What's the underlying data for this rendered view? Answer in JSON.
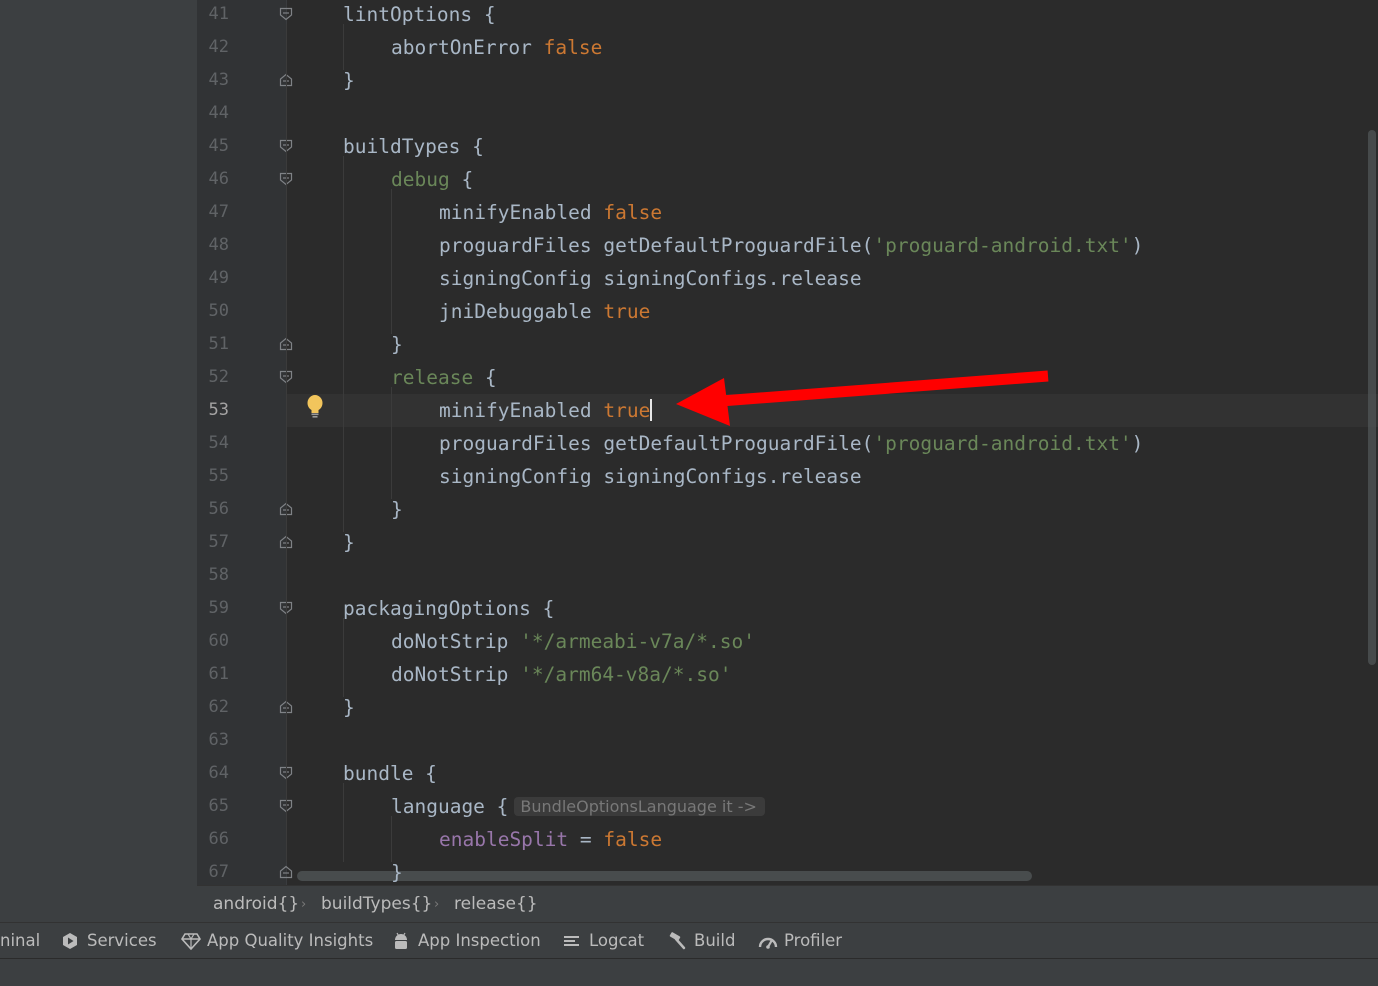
{
  "editor": {
    "current_line": "53",
    "lines": [
      {
        "no": "41",
        "tokens": [
          {
            "t": "lintOptions {"
          }
        ]
      },
      {
        "no": "42",
        "tokens": [
          {
            "t": "abortOnError "
          },
          {
            "t": "false",
            "c": "kw"
          }
        ]
      },
      {
        "no": "43",
        "tokens": [
          {
            "t": "}"
          }
        ]
      },
      {
        "no": "44",
        "tokens": []
      },
      {
        "no": "45",
        "tokens": [
          {
            "t": "buildTypes {"
          }
        ]
      },
      {
        "no": "46",
        "tokens": [
          {
            "t": "debug",
            "c": "green"
          },
          {
            "t": " {"
          }
        ]
      },
      {
        "no": "47",
        "tokens": [
          {
            "t": "minifyEnabled "
          },
          {
            "t": "false",
            "c": "kw"
          }
        ]
      },
      {
        "no": "48",
        "tokens": [
          {
            "t": "proguardFiles getDefaultProguardFile("
          },
          {
            "t": "'proguard-android.txt'",
            "c": "str"
          },
          {
            "t": ")"
          }
        ]
      },
      {
        "no": "49",
        "tokens": [
          {
            "t": "signingConfig signingConfigs.release"
          }
        ]
      },
      {
        "no": "50",
        "tokens": [
          {
            "t": "jniDebuggable "
          },
          {
            "t": "true",
            "c": "kw"
          }
        ]
      },
      {
        "no": "51",
        "tokens": [
          {
            "t": "}"
          }
        ]
      },
      {
        "no": "52",
        "tokens": [
          {
            "t": "release",
            "c": "green"
          },
          {
            "t": " {"
          }
        ]
      },
      {
        "no": "53",
        "tokens": [
          {
            "t": "minifyEnabled "
          },
          {
            "t": "true",
            "c": "kw"
          }
        ]
      },
      {
        "no": "54",
        "tokens": [
          {
            "t": "proguardFiles getDefaultProguardFile("
          },
          {
            "t": "'proguard-android.txt'",
            "c": "str"
          },
          {
            "t": ")"
          }
        ]
      },
      {
        "no": "55",
        "tokens": [
          {
            "t": "signingConfig signingConfigs.release"
          }
        ]
      },
      {
        "no": "56",
        "tokens": [
          {
            "t": "}"
          }
        ]
      },
      {
        "no": "57",
        "tokens": [
          {
            "t": "}"
          }
        ]
      },
      {
        "no": "58",
        "tokens": []
      },
      {
        "no": "59",
        "tokens": [
          {
            "t": "packagingOptions {"
          }
        ]
      },
      {
        "no": "60",
        "tokens": [
          {
            "t": "doNotStrip "
          },
          {
            "t": "'*/armeabi-v7a/*.so'",
            "c": "str"
          }
        ]
      },
      {
        "no": "61",
        "tokens": [
          {
            "t": "doNotStrip "
          },
          {
            "t": "'*/arm64-v8a/*.so'",
            "c": "str"
          }
        ]
      },
      {
        "no": "62",
        "tokens": [
          {
            "t": "}"
          }
        ]
      },
      {
        "no": "63",
        "tokens": []
      },
      {
        "no": "64",
        "tokens": [
          {
            "t": "bundle {"
          }
        ]
      },
      {
        "no": "65",
        "tokens": [
          {
            "t": "language {"
          }
        ]
      },
      {
        "no": "66",
        "tokens": [
          {
            "t": "enableSplit",
            "c": "prop"
          },
          {
            "t": " = "
          },
          {
            "t": "false",
            "c": "kw"
          }
        ]
      },
      {
        "no": "67",
        "tokens": [
          {
            "t": "}"
          }
        ]
      }
    ],
    "inlay_hint": "BundleOptionsLanguage it ->"
  },
  "breadcrumb": [
    "android{}",
    "buildTypes{}",
    "release{}"
  ],
  "toolbar": {
    "terminal_label": "ninal",
    "services_label": "Services",
    "app_quality_label": "App Quality Insights",
    "app_inspection_label": "App Inspection",
    "logcat_label": "Logcat",
    "build_label": "Build",
    "profiler_label": "Profiler"
  },
  "colors": {
    "keyword": "#cc7832",
    "string": "#6a8759",
    "text": "#a9b7c6",
    "property": "#9876aa",
    "annotation_arrow": "#ff0000",
    "bulb": "#f2c55c"
  },
  "icons": [
    "lightbulb-icon",
    "fold-open-icon",
    "fold-close-icon",
    "services-icon",
    "diamond-icon",
    "android-icon",
    "logcat-icon",
    "hammer-icon",
    "gauge-icon"
  ]
}
